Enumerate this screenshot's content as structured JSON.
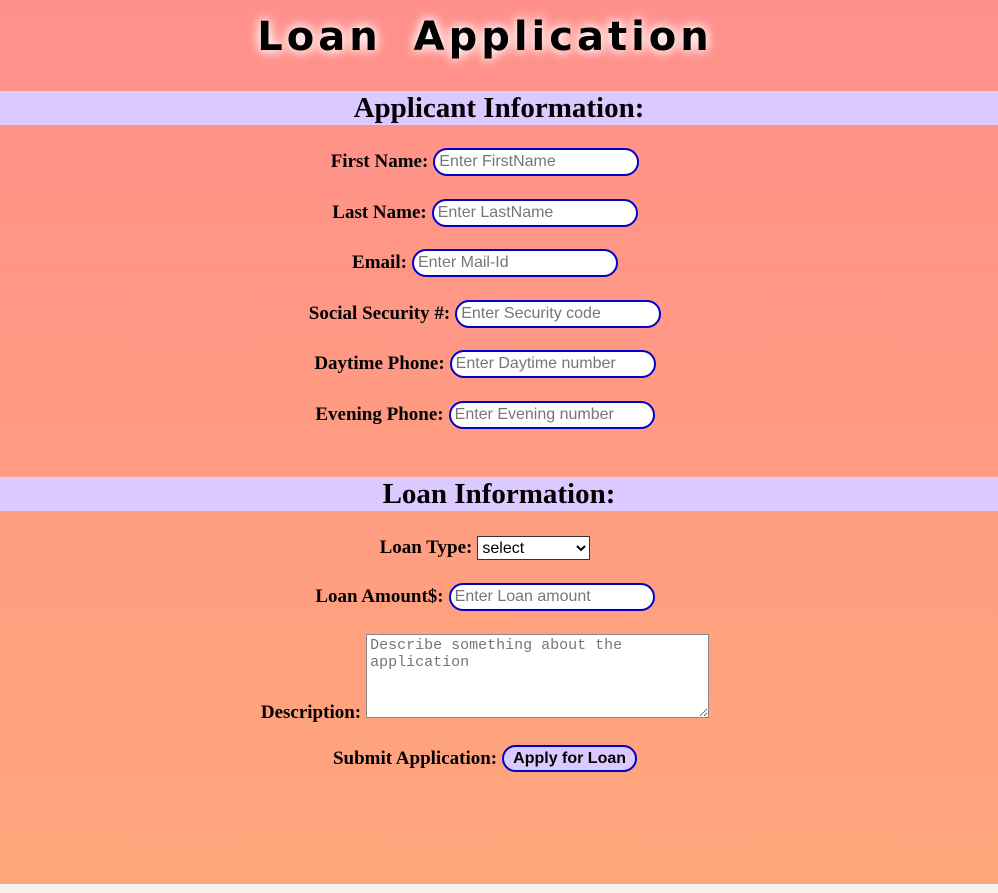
{
  "page": {
    "title": "Loan Application"
  },
  "applicant": {
    "heading": "Applicant Information:",
    "first_name": {
      "label": "First Name:",
      "placeholder": "Enter FirstName"
    },
    "last_name": {
      "label": "Last Name:",
      "placeholder": "Enter LastName"
    },
    "email": {
      "label": "Email:",
      "placeholder": "Enter Mail-Id"
    },
    "ssn": {
      "label": "Social Security #:",
      "placeholder": "Enter Security code"
    },
    "day_phone": {
      "label": "Daytime Phone:",
      "placeholder": "Enter Daytime number"
    },
    "eve_phone": {
      "label": "Evening Phone:",
      "placeholder": "Enter Evening number"
    }
  },
  "loan": {
    "heading": "Loan Information:",
    "type": {
      "label": "Loan Type:",
      "selected": "select"
    },
    "amount": {
      "label": "Loan Amount$:",
      "placeholder": "Enter Loan amount"
    },
    "description": {
      "label": "Description:",
      "placeholder": "Describe something about the application"
    },
    "submit": {
      "label": "Submit Application:",
      "button": "Apply for Loan"
    }
  },
  "colors": {
    "background_top": "#ff8f8c",
    "background_bottom": "#ffa67c",
    "band": "#dcc9ff",
    "input_border": "#0000c8"
  }
}
